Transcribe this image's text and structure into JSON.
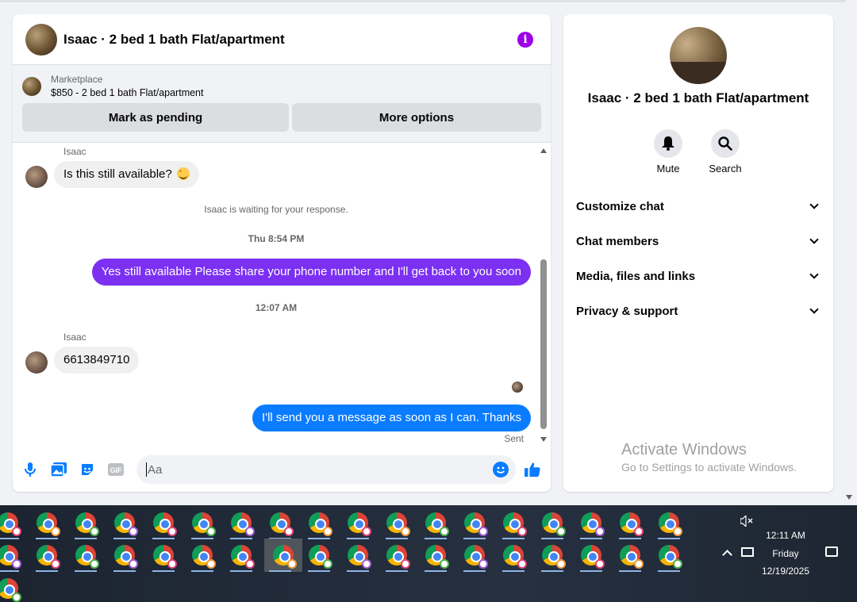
{
  "chat": {
    "title": "Isaac · 2 bed 1 bath Flat/apartment",
    "marketplace_label": "Marketplace",
    "listing": "$850 - 2 bed 1 bath Flat/apartment",
    "buttons": {
      "pending": "Mark as pending",
      "more": "More options"
    },
    "messages": [
      {
        "sender": "Isaac",
        "text": "Is this still available?",
        "direction": "in"
      },
      {
        "system": "Isaac is waiting for your response."
      },
      {
        "timestamp": "Thu 8:54 PM"
      },
      {
        "text": "Yes still available Please share your phone number and I'll get back to you soon",
        "direction": "out",
        "color": "#7b30f2"
      },
      {
        "timestamp": "12:07 AM"
      },
      {
        "sender": "Isaac",
        "text": "6613849710",
        "direction": "in"
      },
      {
        "text": "I'll send you a message as soon as I can. Thanks",
        "direction": "out",
        "color": "#0a7cff",
        "status": "Sent"
      }
    ],
    "composer_placeholder": "Aa"
  },
  "info_panel": {
    "title": "Isaac · 2 bed 1 bath Flat/apartment",
    "actions": [
      {
        "label": "Mute",
        "icon": "bell-icon"
      },
      {
        "label": "Search",
        "icon": "search-icon"
      }
    ],
    "sections": [
      "Customize chat",
      "Chat members",
      "Media, files and links",
      "Privacy & support"
    ]
  },
  "watermark": {
    "title": "Activate Windows",
    "subtitle": "Go to Settings to activate Windows."
  },
  "taskbar": {
    "time": "12:11 AM",
    "day": "Friday",
    "date": "12/19/2025",
    "row1_count": 18,
    "row2_count": 18
  },
  "colors": {
    "accent": "#0a7cff",
    "purple_bubble": "#7b30f2",
    "info": "#9b00e6"
  }
}
